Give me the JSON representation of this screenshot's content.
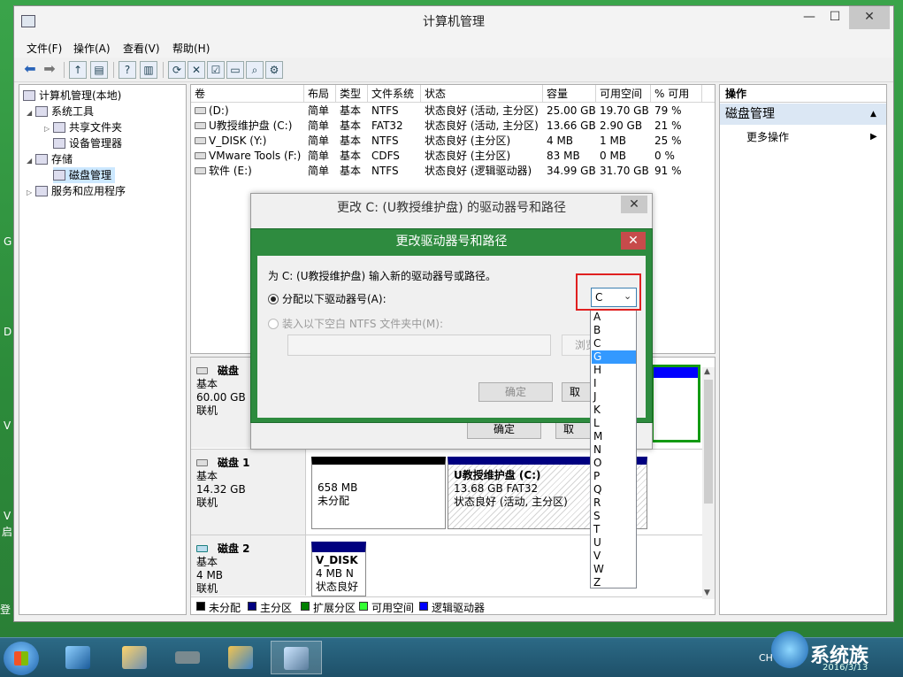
{
  "window": {
    "title": "计算机管理",
    "min": "—",
    "max": "☐",
    "close": "✕"
  },
  "menu": [
    "文件(F)",
    "操作(A)",
    "查看(V)",
    "帮助(H)"
  ],
  "tree": {
    "root": "计算机管理(本地)",
    "system_tools": "系统工具",
    "shared_folders": "共享文件夹",
    "device_manager": "设备管理器",
    "storage": "存储",
    "disk_management": "磁盘管理",
    "services_apps": "服务和应用程序"
  },
  "volumes": {
    "headers": [
      "卷",
      "布局",
      "类型",
      "文件系统",
      "状态",
      "容量",
      "可用空间",
      "% 可用"
    ],
    "rows": [
      [
        "(D:)",
        "简单",
        "基本",
        "NTFS",
        "状态良好 (活动, 主分区)",
        "25.00 GB",
        "19.70 GB",
        "79 %"
      ],
      [
        "U教授维护盘 (C:)",
        "简单",
        "基本",
        "FAT32",
        "状态良好 (活动, 主分区)",
        "13.66 GB",
        "2.90 GB",
        "21 %"
      ],
      [
        "V_DISK (Y:)",
        "简单",
        "基本",
        "NTFS",
        "状态良好 (主分区)",
        "4 MB",
        "1 MB",
        "25 %"
      ],
      [
        "VMware Tools (F:)",
        "简单",
        "基本",
        "CDFS",
        "状态良好 (主分区)",
        "83 MB",
        "0 MB",
        "0 %"
      ],
      [
        "软件 (E:)",
        "简单",
        "基本",
        "NTFS",
        "状态良好 (逻辑驱动器)",
        "34.99 GB",
        "31.70 GB",
        "91 %"
      ]
    ]
  },
  "disks": {
    "disk0": {
      "name": "磁盘",
      "type": "基本",
      "size": "60.00 GB",
      "status": "联机"
    },
    "disk1": {
      "name": "磁盘 1",
      "type": "基本",
      "size": "14.32 GB",
      "status": "联机",
      "unalloc_size": "658 MB",
      "unalloc_label": "未分配",
      "part_name": "U教授维护盘  (C:)",
      "part_size": "13.68 GB FAT32",
      "part_status": "状态良好 (活动, 主分区)"
    },
    "disk2": {
      "name": "磁盘 2",
      "type": "基本",
      "size": "4 MB",
      "status": "联机",
      "part_name": "V_DISK",
      "part_size": "4 MB N",
      "part_status": "状态良好"
    }
  },
  "legend": [
    "未分配",
    "主分区",
    "扩展分区",
    "可用空间",
    "逻辑驱动器"
  ],
  "legend_colors": [
    "#000000",
    "#000080",
    "#008000",
    "#33ff33",
    "#0000ff"
  ],
  "actions": {
    "header": "操作",
    "section": "磁盘管理",
    "more": "更多操作"
  },
  "dialog_outer": {
    "title": "更改 C: (U教授维护盘) 的驱动器号和路径",
    "ok": "确定",
    "cancel": "取"
  },
  "dialog_inner": {
    "title": "更改驱动器号和路径",
    "prompt": "为 C: (U教授维护盘) 输入新的驱动器号或路径。",
    "assign_label": "分配以下驱动器号(A):",
    "mount_label": "装入以下空白 NTFS 文件夹中(M):",
    "browse": "浏览",
    "ok": "确定",
    "cancel": "取"
  },
  "dropdown": {
    "selected": "C",
    "options": [
      "A",
      "B",
      "C",
      "G",
      "H",
      "I",
      "J",
      "K",
      "L",
      "M",
      "N",
      "O",
      "P",
      "Q",
      "R",
      "S",
      "T",
      "U",
      "V",
      "W",
      "Z"
    ],
    "highlighted": "G"
  },
  "desktop_chars": [
    "G",
    "D",
    "V",
    "V",
    "启",
    "登"
  ],
  "taskbar": {
    "clock": "2016/3/13",
    "lang": "CH",
    "watermark": "系统族"
  }
}
